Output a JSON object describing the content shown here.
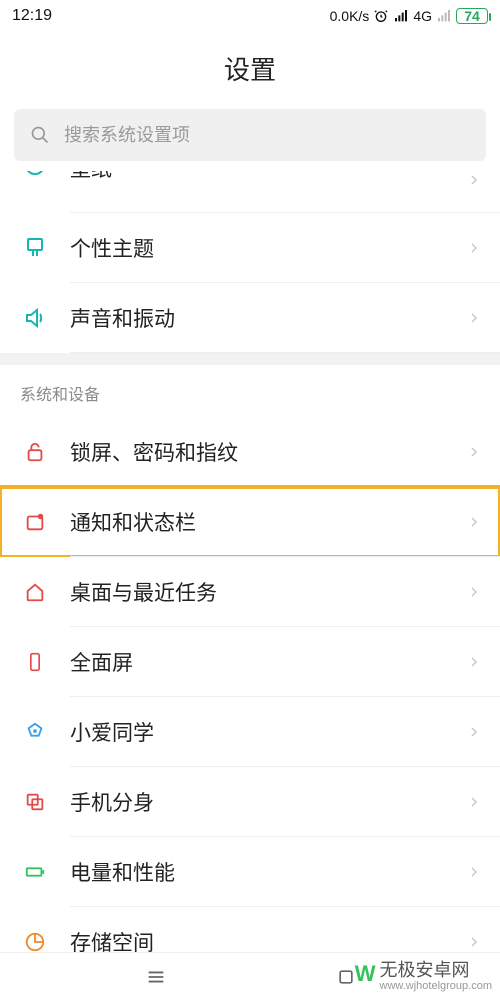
{
  "status": {
    "time": "12:19",
    "net_speed": "0.0K/s",
    "network_label": "4G",
    "battery_pct": "74"
  },
  "header": {
    "title": "设置"
  },
  "search": {
    "placeholder": "搜索系统设置项"
  },
  "top_partial_row": {
    "label": "壁纸"
  },
  "group1": [
    {
      "icon": "theme-icon",
      "label": "个性主题"
    },
    {
      "icon": "sound-icon",
      "label": "声音和振动"
    }
  ],
  "section2_header": "系统和设备",
  "group2": [
    {
      "icon": "lock-icon",
      "label": "锁屏、密码和指纹",
      "highlighted": false
    },
    {
      "icon": "notif-icon",
      "label": "通知和状态栏",
      "highlighted": true
    },
    {
      "icon": "home-icon",
      "label": "桌面与最近任务",
      "highlighted": false
    },
    {
      "icon": "fullscreen-icon",
      "label": "全面屏",
      "highlighted": false
    },
    {
      "icon": "xiaoai-icon",
      "label": "小爱同学",
      "highlighted": false
    },
    {
      "icon": "clone-icon",
      "label": "手机分身",
      "highlighted": false
    },
    {
      "icon": "battery-icon",
      "label": "电量和性能",
      "highlighted": false
    },
    {
      "icon": "storage-icon",
      "label": "存储空间",
      "highlighted": false
    }
  ],
  "watermark": {
    "brand": "无极安卓网",
    "url": "www.wjhotelgroup.com"
  },
  "colors": {
    "accent_teal": "#16b7b0",
    "accent_red": "#e34b4b",
    "accent_blue": "#3aa0e8",
    "accent_orange": "#ef8a2c",
    "accent_green": "#35c25b",
    "highlight": "#f3b128",
    "arrow": "#ff1f1f"
  }
}
